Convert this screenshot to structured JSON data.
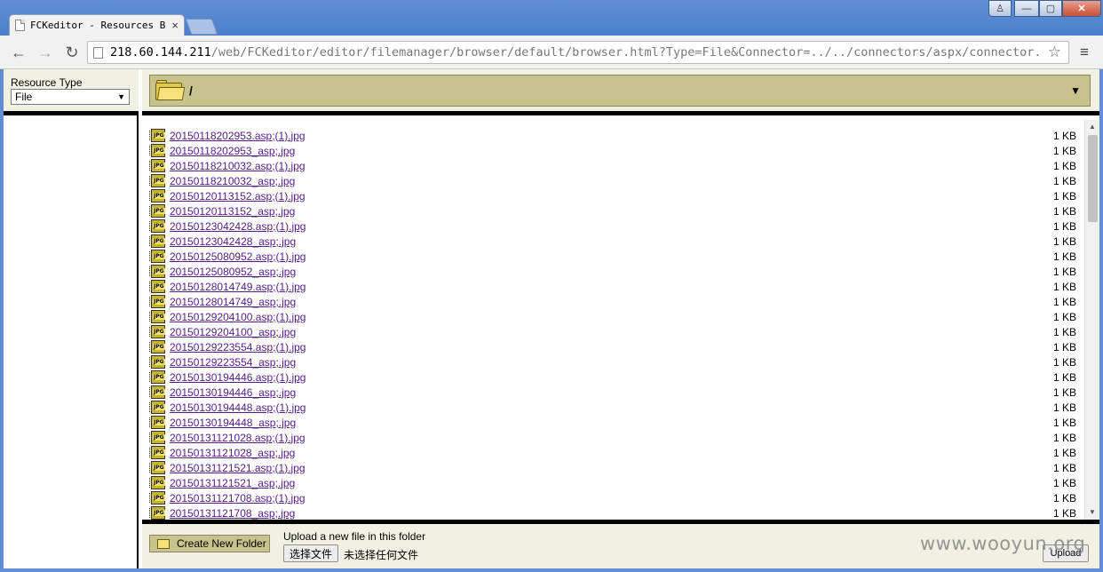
{
  "browser": {
    "tab_title": "FCKeditor - Resources B",
    "url_host": "218.60.144.211",
    "url_path": "/web/FCKeditor/editor/filemanager/browser/default/browser.html?Type=File&Connector=../../connectors/aspx/connector.asp",
    "tab_close": "×",
    "back": "←",
    "forward": "→",
    "reload": "↻",
    "star": "☆",
    "menu": "≡",
    "win_min": "—",
    "win_max": "▢",
    "win_close": "✕",
    "win_user": "♙"
  },
  "resource_type": {
    "label": "Resource Type",
    "selected": "File"
  },
  "folder": {
    "path": "/",
    "dropdown": "▼"
  },
  "files": [
    {
      "name": "20150118202953.asp;(1).jpg",
      "size": "1 KB"
    },
    {
      "name": "20150118202953_asp;.jpg",
      "size": "1 KB"
    },
    {
      "name": "20150118210032.asp;(1).jpg",
      "size": "1 KB"
    },
    {
      "name": "20150118210032_asp;.jpg",
      "size": "1 KB"
    },
    {
      "name": "20150120113152.asp;(1).jpg",
      "size": "1 KB"
    },
    {
      "name": "20150120113152_asp;.jpg",
      "size": "1 KB"
    },
    {
      "name": "20150123042428.asp;(1).jpg",
      "size": "1 KB"
    },
    {
      "name": "20150123042428_asp;.jpg",
      "size": "1 KB"
    },
    {
      "name": "20150125080952.asp;(1).jpg",
      "size": "1 KB"
    },
    {
      "name": "20150125080952_asp;.jpg",
      "size": "1 KB"
    },
    {
      "name": "20150128014749.asp;(1).jpg",
      "size": "1 KB"
    },
    {
      "name": "20150128014749_asp;.jpg",
      "size": "1 KB"
    },
    {
      "name": "20150129204100.asp;(1).jpg",
      "size": "1 KB"
    },
    {
      "name": "20150129204100_asp;.jpg",
      "size": "1 KB"
    },
    {
      "name": "20150129223554.asp;(1).jpg",
      "size": "1 KB"
    },
    {
      "name": "20150129223554_asp;.jpg",
      "size": "1 KB"
    },
    {
      "name": "20150130194446.asp;(1).jpg",
      "size": "1 KB"
    },
    {
      "name": "20150130194446_asp;.jpg",
      "size": "1 KB"
    },
    {
      "name": "20150130194448.asp;(1).jpg",
      "size": "1 KB"
    },
    {
      "name": "20150130194448_asp;.jpg",
      "size": "1 KB"
    },
    {
      "name": "20150131121028.asp;(1).jpg",
      "size": "1 KB"
    },
    {
      "name": "20150131121028_asp;.jpg",
      "size": "1 KB"
    },
    {
      "name": "20150131121521.asp;(1).jpg",
      "size": "1 KB"
    },
    {
      "name": "20150131121521_asp;.jpg",
      "size": "1 KB"
    },
    {
      "name": "20150131121708.asp;(1).jpg",
      "size": "1 KB"
    },
    {
      "name": "20150131121708_asp;.jpg",
      "size": "1 KB"
    }
  ],
  "actions": {
    "create_folder": "Create New Folder",
    "upload_label": "Upload a new file in this folder",
    "choose_file": "选择文件",
    "no_file": "未选择任何文件",
    "upload": "Upload"
  },
  "watermark": "www.wooyun.org"
}
